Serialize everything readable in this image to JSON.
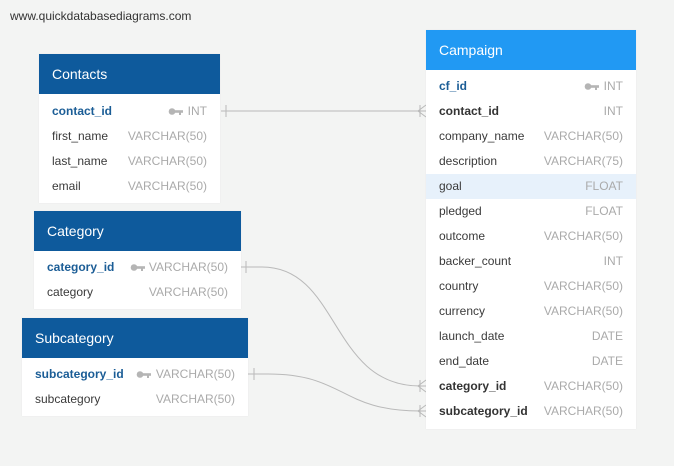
{
  "watermark": "www.quickdatabasediagrams.com",
  "contacts": {
    "title": "Contacts",
    "columns": [
      {
        "name": "contact_id",
        "type": "INT"
      },
      {
        "name": "first_name",
        "type": "VARCHAR(50)"
      },
      {
        "name": "last_name",
        "type": "VARCHAR(50)"
      },
      {
        "name": "email",
        "type": "VARCHAR(50)"
      }
    ]
  },
  "category": {
    "title": "Category",
    "columns": [
      {
        "name": "category_id",
        "type": "VARCHAR(50)"
      },
      {
        "name": "category",
        "type": "VARCHAR(50)"
      }
    ]
  },
  "subcategory": {
    "title": "Subcategory",
    "columns": [
      {
        "name": "subcategory_id",
        "type": "VARCHAR(50)"
      },
      {
        "name": "subcategory",
        "type": "VARCHAR(50)"
      }
    ]
  },
  "campaign": {
    "title": "Campaign",
    "columns": [
      {
        "name": "cf_id",
        "type": "INT"
      },
      {
        "name": "contact_id",
        "type": "INT"
      },
      {
        "name": "company_name",
        "type": "VARCHAR(50)"
      },
      {
        "name": "description",
        "type": "VARCHAR(75)"
      },
      {
        "name": "goal",
        "type": "FLOAT"
      },
      {
        "name": "pledged",
        "type": "FLOAT"
      },
      {
        "name": "outcome",
        "type": "VARCHAR(50)"
      },
      {
        "name": "backer_count",
        "type": "INT"
      },
      {
        "name": "country",
        "type": "VARCHAR(50)"
      },
      {
        "name": "currency",
        "type": "VARCHAR(50)"
      },
      {
        "name": "launch_date",
        "type": "DATE"
      },
      {
        "name": "end_date",
        "type": "DATE"
      },
      {
        "name": "category_id",
        "type": "VARCHAR(50)"
      },
      {
        "name": "subcategory_id",
        "type": "VARCHAR(50)"
      }
    ]
  },
  "colors": {
    "header_dark": "#0e5a9c",
    "header_light": "#2199f3",
    "primary_key_text": "#1b5d96",
    "type_text": "#aaaaaa",
    "highlight_row": "#e7f1fb",
    "relationship_line": "#b9b9b9"
  },
  "icons": {
    "primary_key": "key-icon"
  }
}
